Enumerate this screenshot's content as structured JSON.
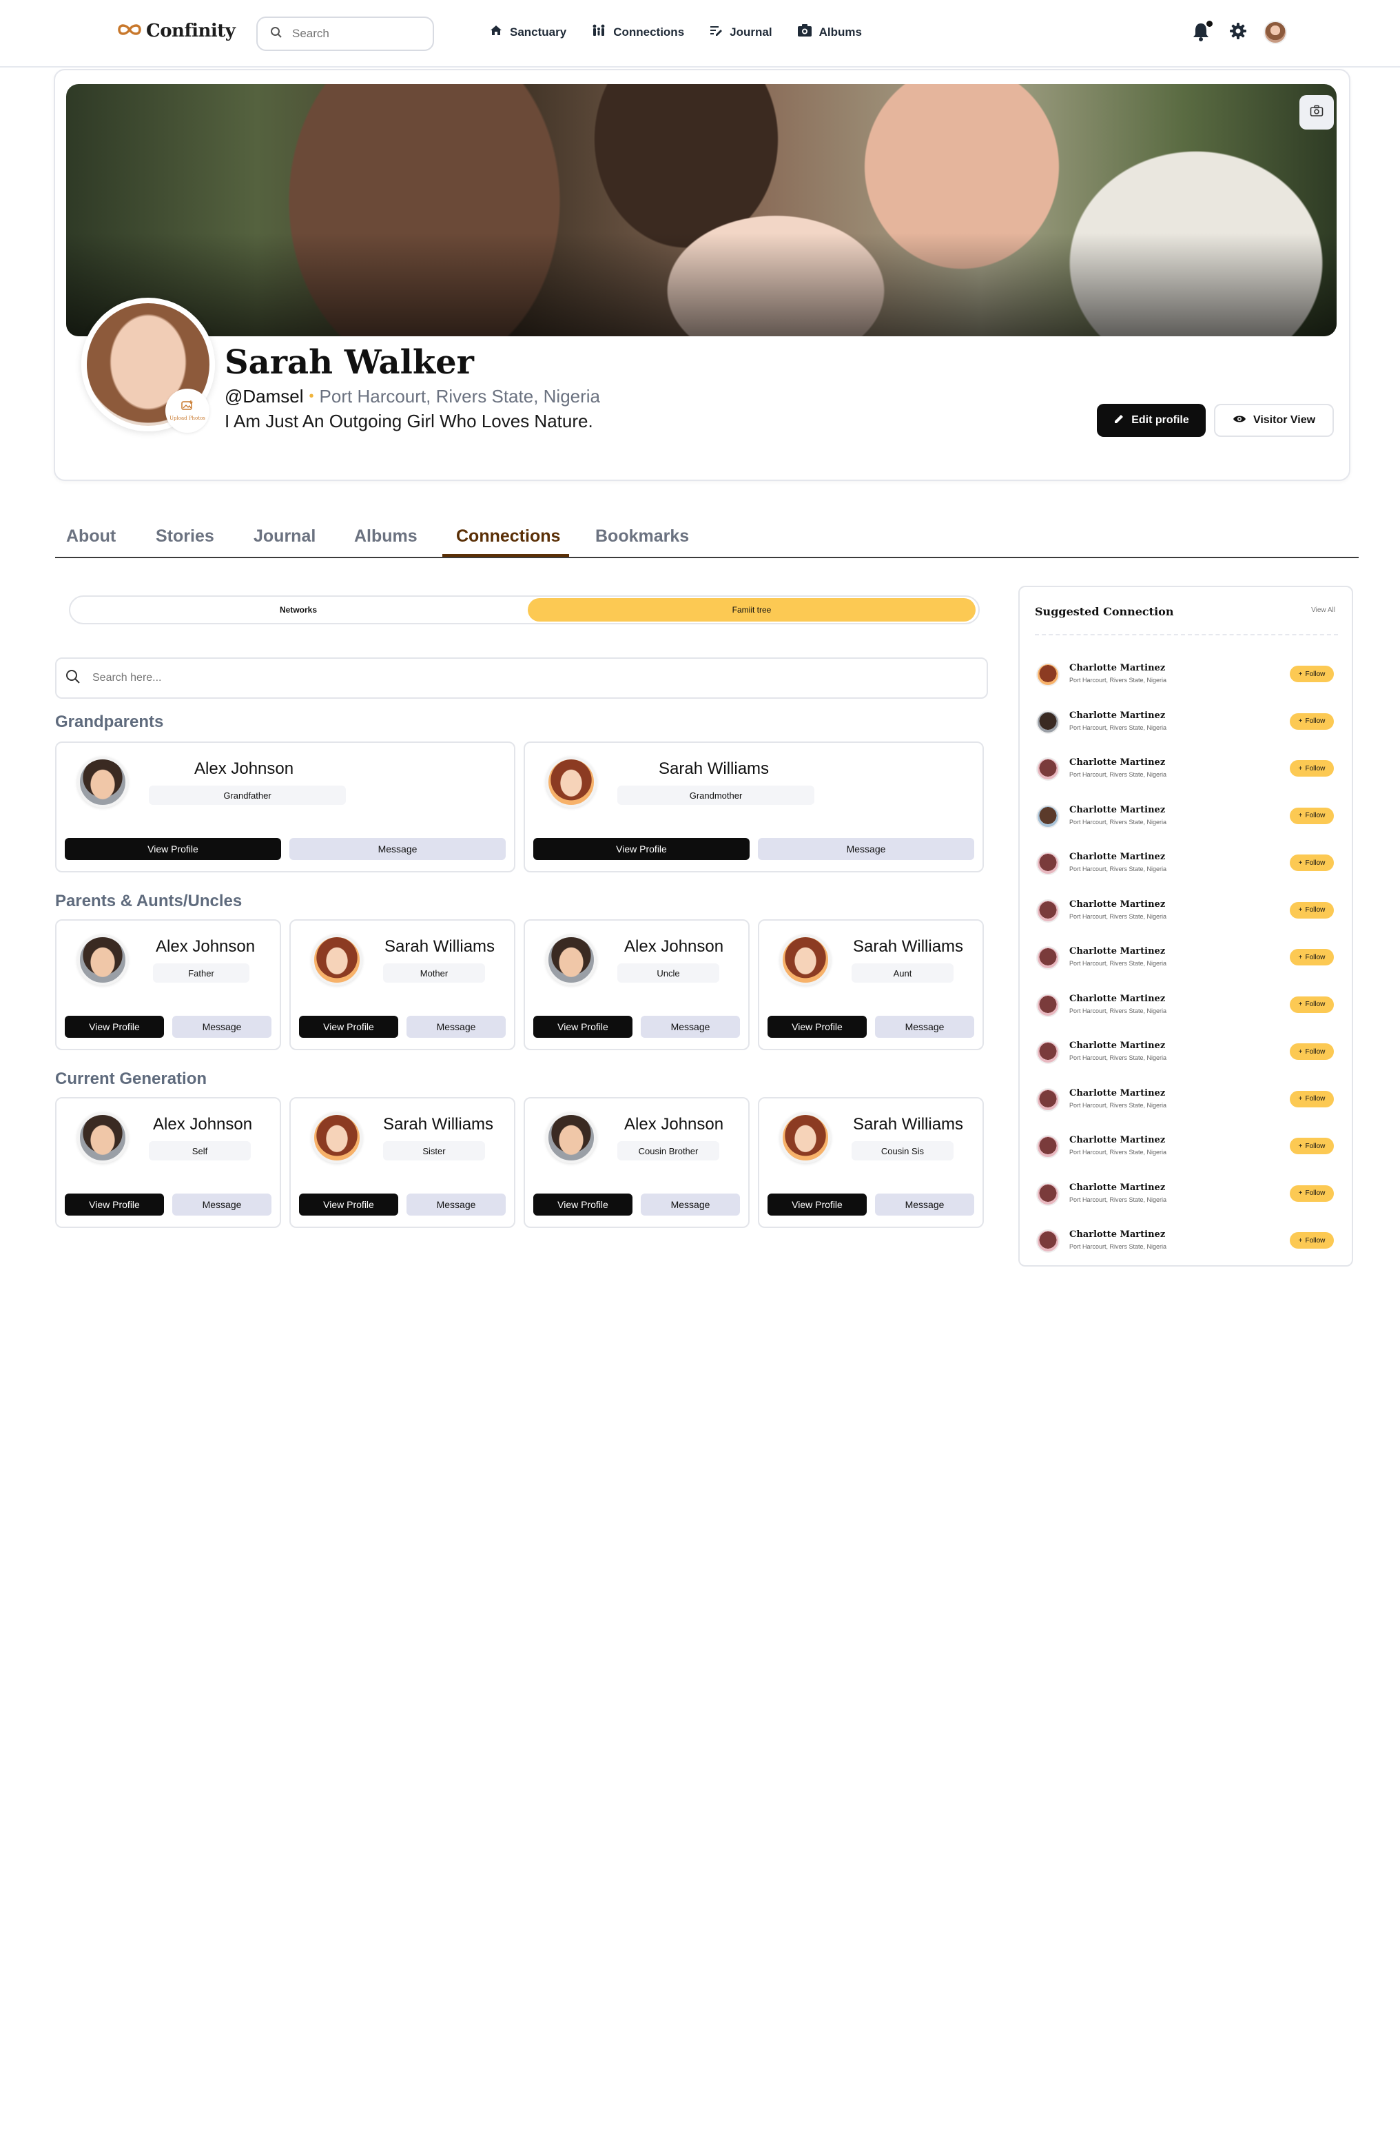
{
  "nav": {
    "brand": "Confinity",
    "search_placeholder": "Search",
    "links": [
      "Sanctuary",
      "Connections",
      "Journal",
      "Albums"
    ]
  },
  "profile": {
    "name": "Sarah Walker",
    "handle": "@Damsel",
    "location": "Port Harcourt, Rivers State, Nigeria",
    "bio": "I Am Just An Outgoing Girl Who Loves Nature.",
    "upload_label": "Upload Photos",
    "edit_label": "Edit profile",
    "visitor_label": "Visitor View"
  },
  "tabs": [
    "About",
    "Stories",
    "Journal",
    "Albums",
    "Connections",
    "Bookmarks"
  ],
  "active_tab": "Connections",
  "segment": {
    "left": "Networks",
    "right": "Famiit tree",
    "active": "right"
  },
  "list_search_placeholder": "Search here...",
  "sections": {
    "grandparents": {
      "title": "Grandparents",
      "members": [
        {
          "name": "Alex Johnson",
          "role": "Grandfather",
          "view": "View  Profile",
          "message": "Message"
        },
        {
          "name": "Sarah Williams",
          "role": "Grandmother",
          "view": "View  Profile",
          "message": "Message"
        }
      ]
    },
    "parents": {
      "title": "Parents & Aunts/Uncles",
      "members": [
        {
          "name": "Alex Johnson",
          "role": "Father",
          "view": "View  Profile",
          "message": "Message"
        },
        {
          "name": "Sarah Williams",
          "role": "Mother",
          "view": "View  Profile",
          "message": "Message"
        },
        {
          "name": "Alex Johnson",
          "role": "Uncle",
          "view": "View  Profile",
          "message": "Message"
        },
        {
          "name": "Sarah Williams",
          "role": "Aunt",
          "view": "View  Profile",
          "message": "Message"
        }
      ]
    },
    "current": {
      "title": "Current Generation",
      "members": [
        {
          "name": "Alex Johnson",
          "role": "Self",
          "view": "View  Profile",
          "message": "Message"
        },
        {
          "name": "Sarah Williams",
          "role": "Sister",
          "view": "View  Profile",
          "message": "Message"
        },
        {
          "name": "Alex Johnson",
          "role": "Cousin Brother",
          "view": "View  Profile",
          "message": "Message"
        },
        {
          "name": "Sarah Williams",
          "role": "Cousin Sis",
          "view": "View  Profile",
          "message": "Message"
        }
      ]
    }
  },
  "suggested": {
    "title": "Suggested Connection",
    "view_all": "View All",
    "follow_label": "Follow",
    "items": [
      {
        "name": "Charlotte Martinez",
        "location": "Port Harcourt, Rivers State, Nigeria"
      },
      {
        "name": "Charlotte Martinez",
        "location": "Port Harcourt, Rivers State, Nigeria"
      },
      {
        "name": "Charlotte Martinez",
        "location": "Port Harcourt, Rivers State, Nigeria"
      },
      {
        "name": "Charlotte Martinez",
        "location": "Port Harcourt, Rivers State, Nigeria"
      },
      {
        "name": "Charlotte Martinez",
        "location": "Port Harcourt, Rivers State, Nigeria"
      },
      {
        "name": "Charlotte Martinez",
        "location": "Port Harcourt, Rivers State, Nigeria"
      },
      {
        "name": "Charlotte Martinez",
        "location": "Port Harcourt, Rivers State, Nigeria"
      },
      {
        "name": "Charlotte Martinez",
        "location": "Port Harcourt, Rivers State, Nigeria"
      },
      {
        "name": "Charlotte Martinez",
        "location": "Port Harcourt, Rivers State, Nigeria"
      },
      {
        "name": "Charlotte Martinez",
        "location": "Port Harcourt, Rivers State, Nigeria"
      },
      {
        "name": "Charlotte Martinez",
        "location": "Port Harcourt, Rivers State, Nigeria"
      },
      {
        "name": "Charlotte Martinez",
        "location": "Port Harcourt, Rivers State, Nigeria"
      },
      {
        "name": "Charlotte Martinez",
        "location": "Port Harcourt, Rivers State, Nigeria"
      }
    ]
  },
  "colors": {
    "accent": "#fcc953",
    "active_tab": "#5a2f06",
    "primary_button": "#0d0d0d",
    "secondary_button": "#dfe1ef"
  }
}
